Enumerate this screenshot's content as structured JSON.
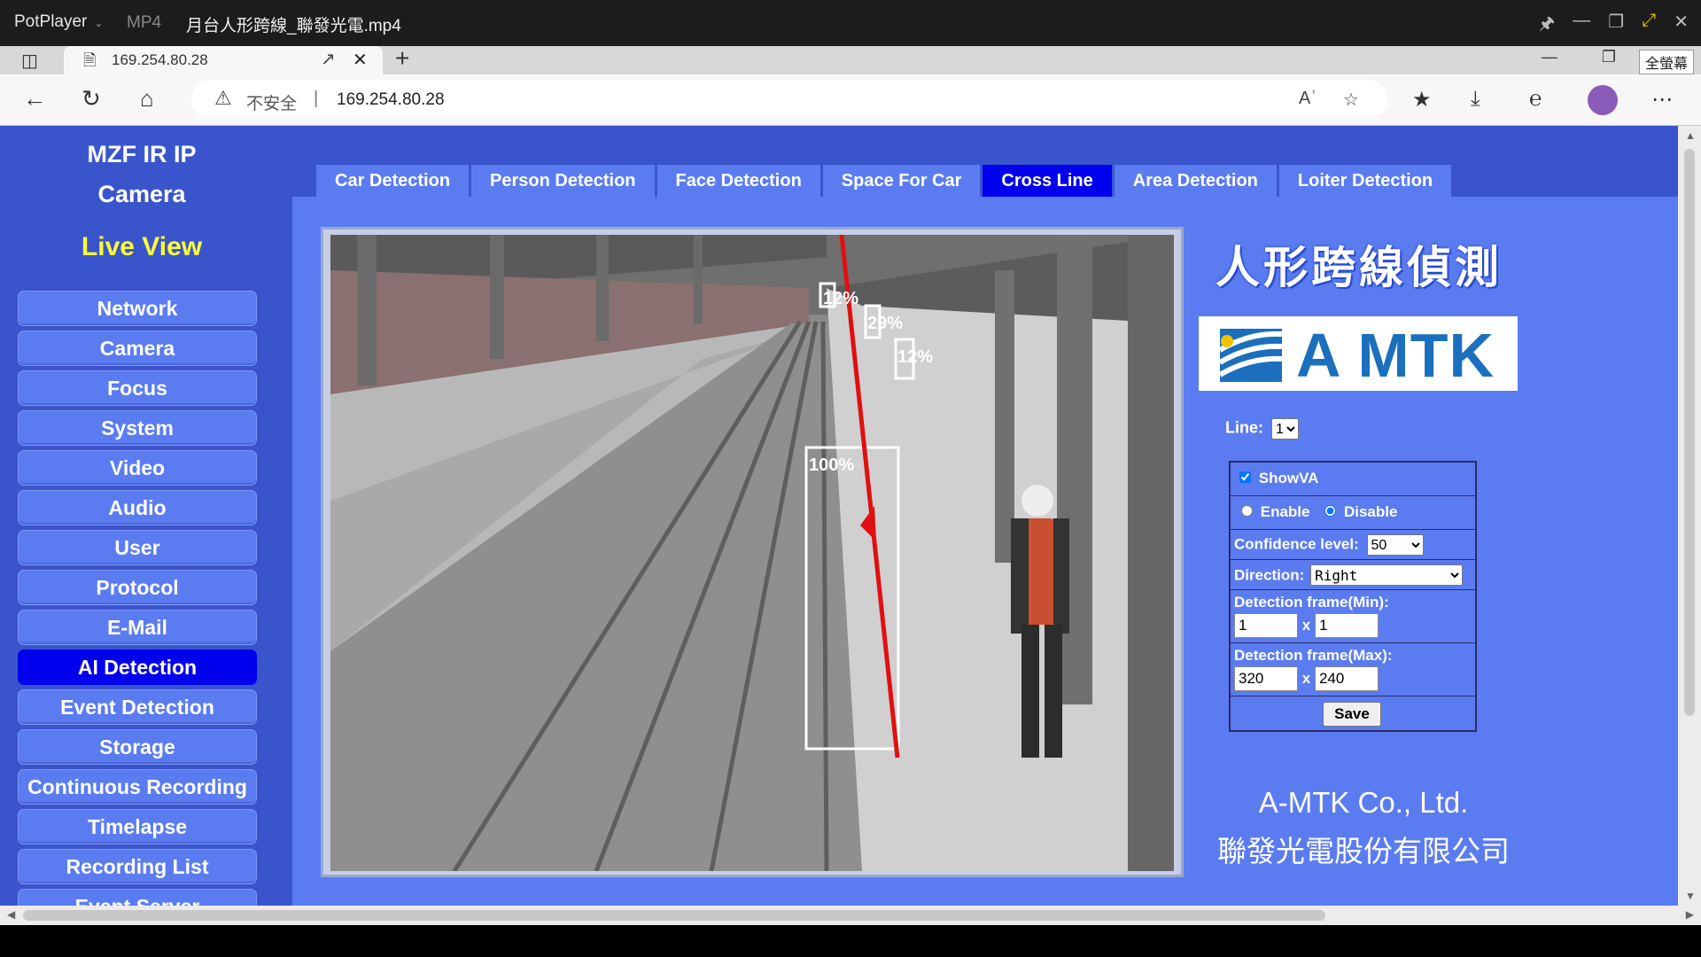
{
  "player": {
    "app_name": "PotPlayer",
    "format": "MP4",
    "filename": "月台人形跨線_聯發光電.mp4"
  },
  "browser": {
    "tab_title": "169.254.80.28",
    "insecure_label": "不安全",
    "url": "169.254.80.28",
    "fullscreen_tooltip": "全螢幕"
  },
  "sidebar": {
    "brand_line1": "MZF IR IP",
    "brand_line2": "Camera",
    "live_view": "Live View",
    "items": [
      {
        "label": "Network"
      },
      {
        "label": "Camera"
      },
      {
        "label": "Focus"
      },
      {
        "label": "System"
      },
      {
        "label": "Video"
      },
      {
        "label": "Audio"
      },
      {
        "label": "User"
      },
      {
        "label": "Protocol"
      },
      {
        "label": "E-Mail"
      },
      {
        "label": "AI Detection",
        "active": true
      },
      {
        "label": "Event Detection"
      },
      {
        "label": "Storage"
      },
      {
        "label": "Continuous Recording"
      },
      {
        "label": "Timelapse"
      },
      {
        "label": "Recording List"
      },
      {
        "label": "Event Server"
      }
    ]
  },
  "tabs": [
    {
      "label": "Car Detection"
    },
    {
      "label": "Person Detection"
    },
    {
      "label": "Face Detection"
    },
    {
      "label": "Space For Car"
    },
    {
      "label": "Cross Line",
      "active": true
    },
    {
      "label": "Area Detection"
    },
    {
      "label": "Loiter Detection"
    }
  ],
  "video": {
    "detections": [
      {
        "label": "12%"
      },
      {
        "label": "29%"
      },
      {
        "label": "12%"
      },
      {
        "label": "100%"
      }
    ]
  },
  "right": {
    "title_cn": "人形跨線偵測",
    "logo_text": "A MTK",
    "line_label": "Line:",
    "line_value": "1",
    "show_va_label": "ShowVA",
    "show_va_checked": true,
    "enable_label": "Enable",
    "disable_label": "Disable",
    "selected_mode": "Disable",
    "confidence_label": "Confidence level:",
    "confidence_value": "50",
    "direction_label": "Direction:",
    "direction_value": "Right",
    "min_label": "Detection frame(Min):",
    "min_w": "1",
    "min_h": "1",
    "max_label": "Detection frame(Max):",
    "max_w": "320",
    "max_h": "240",
    "times": "x",
    "save_label": "Save",
    "company_en": "A-MTK Co., Ltd.",
    "company_cn": "聯發光電股份有限公司"
  },
  "colors": {
    "page_bg": "#3a55cc",
    "panel_bg": "#5b7cf0",
    "active": "#0000ee",
    "live_view": "#ffff33",
    "line": "#e01010"
  }
}
